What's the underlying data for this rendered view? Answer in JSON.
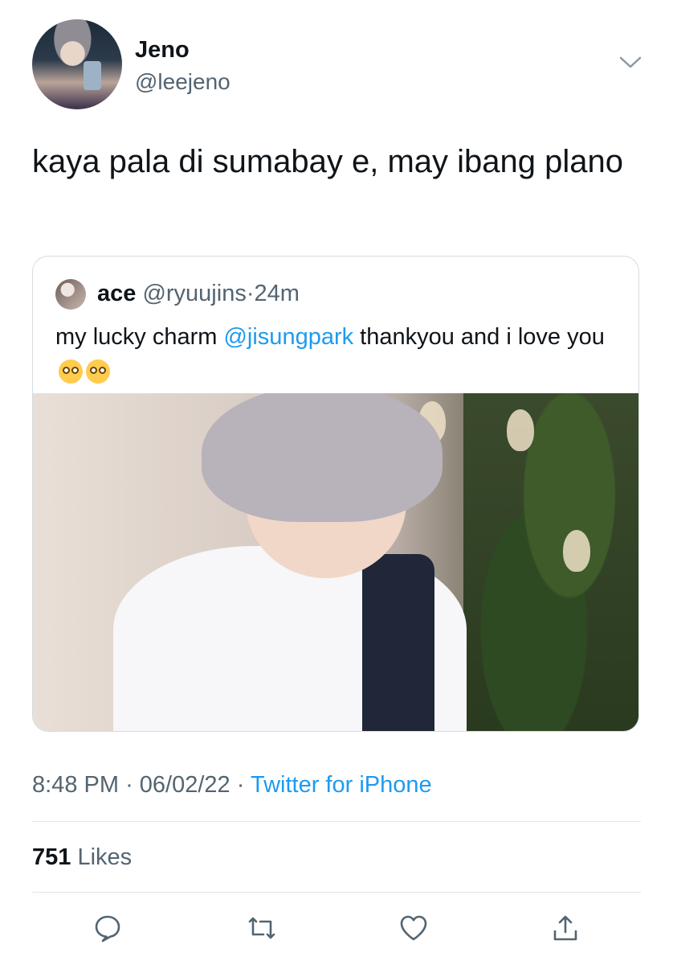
{
  "author": {
    "name": "Jeno",
    "handle": "@leejeno"
  },
  "tweet": {
    "text": "kaya pala di sumabay e, may ibang plano"
  },
  "quoted": {
    "name": "ace",
    "handle": "@ryuujins",
    "separator": "·",
    "time": "24m",
    "text_before": "my lucky charm ",
    "mention": "@jisungpark",
    "text_after": " thankyou and i love you",
    "emojis": [
      "flushed-face-emoji",
      "pleading-face-emoji"
    ]
  },
  "meta": {
    "time": "8:48 PM",
    "date": "06/02/22",
    "separator": "·",
    "source": "Twitter for iPhone"
  },
  "stats": {
    "likes_count": "751",
    "likes_label": "Likes"
  },
  "actions": [
    "reply-icon",
    "retweet-icon",
    "like-icon",
    "share-icon"
  ],
  "colors": {
    "link": "#1d9bf0",
    "secondary_text": "#536471",
    "border": "#d5dce1"
  }
}
